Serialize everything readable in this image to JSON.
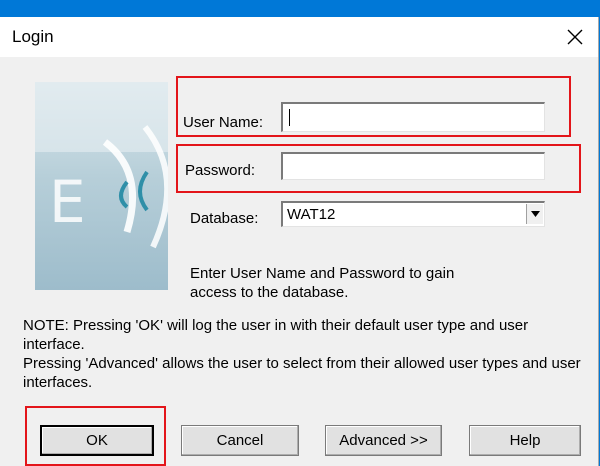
{
  "dialog": {
    "title": "Login"
  },
  "form": {
    "username_label": "User Name:",
    "username_value": "",
    "password_label": "Password:",
    "password_value": "",
    "database_label": "Database:",
    "database_value": "WAT12"
  },
  "info": {
    "instruction": "Enter User Name and Password to gain access to the database.",
    "note": "NOTE:  Pressing 'OK' will log the user in with their default user type and user interface.",
    "advanced_note": "Pressing 'Advanced' allows the user to select from their allowed user types and user interfaces."
  },
  "buttons": {
    "ok": "OK",
    "cancel": "Cancel",
    "advanced": "Advanced >>",
    "help": "Help"
  },
  "colors": {
    "highlight": "#e3151a",
    "desktop": "#0078d7"
  },
  "icons": {
    "close": "close-icon",
    "dropdown": "chevron-down-icon"
  }
}
